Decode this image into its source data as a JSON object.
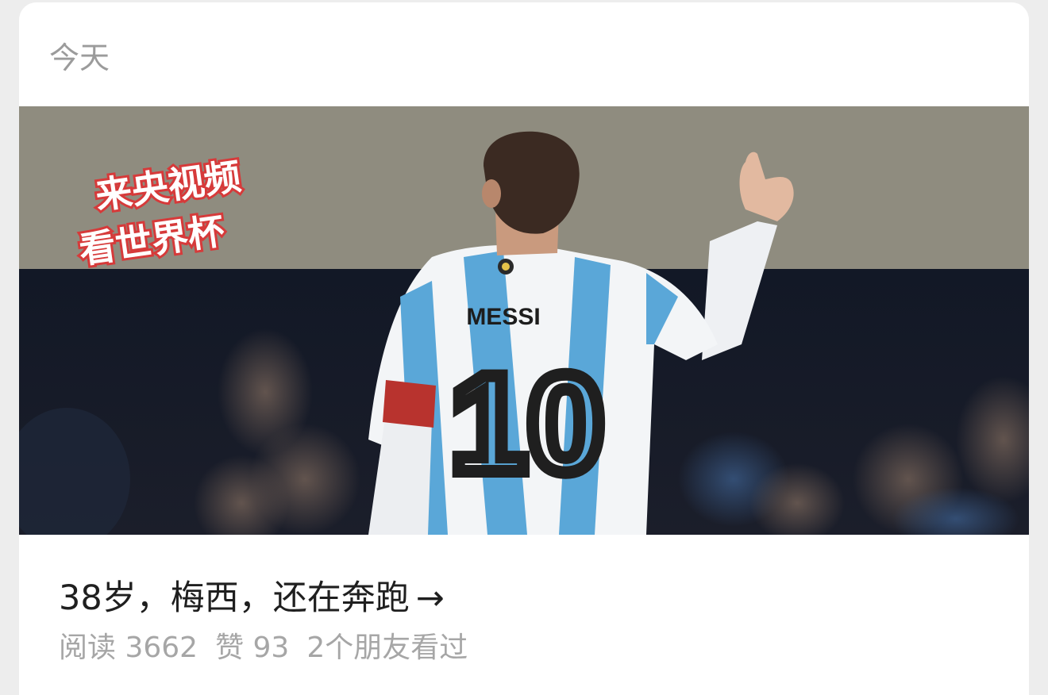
{
  "header": {
    "date_label": "今天"
  },
  "article": {
    "cover": {
      "alt_brand_line1": "来央视频",
      "alt_brand_line2": "看世界杯",
      "jersey_name": "MESSI",
      "jersey_number": "10"
    },
    "title": "38岁，梅西，还在奔跑",
    "title_arrow": "→",
    "stats": {
      "reads": "阅读 3662",
      "likes": "赞 93",
      "friends": "2个朋友看过"
    }
  }
}
